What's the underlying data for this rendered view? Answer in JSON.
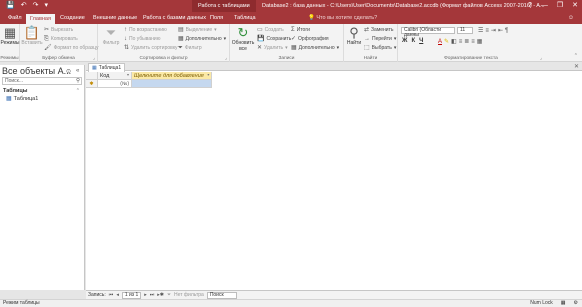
{
  "title_bar": {
    "context_tab": "Работа с таблицами",
    "title": "Database2 : база данных - C:\\Users\\User\\Documents\\Database2.accdb (Формат файлов Access 2007-2016) - A...",
    "qat": {
      "save": "💾",
      "undo": "↶",
      "redo": "↷",
      "more": "▾"
    },
    "controls": {
      "minimize": "—",
      "restore": "❐",
      "close": "✕",
      "help": "?"
    }
  },
  "tabs": {
    "file": "Файл",
    "home": "Главная",
    "create": "Создание",
    "external": "Внешние данные",
    "dbtools": "Работа с базами данных",
    "fields": "Поля",
    "table": "Таблица",
    "tellme": "Что вы хотите сделать?",
    "signin": "☺"
  },
  "ribbon": {
    "views": {
      "view_label": "Режимы",
      "group_label": "Режимы",
      "glyph": "▦"
    },
    "clipboard": {
      "paste": "Вставить",
      "cut": "Вырезать",
      "copy": "Копировать",
      "format_painter": "Формат по образцу",
      "group_label": "Буфер обмена"
    },
    "sort_filter": {
      "filter": "Фильтр",
      "ascending": "По возрастанию",
      "descending": "По убыванию",
      "remove_sort": "Удалить сортировку",
      "selection": "Выделение",
      "advanced": "Дополнительно",
      "toggle": "Фильтр",
      "group_label": "Сортировка и фильтр"
    },
    "records": {
      "refresh": "Обновить все",
      "new": "Создать",
      "save": "Сохранить",
      "delete": "Удалить",
      "totals": "Итоги",
      "spelling": "Орфография",
      "more": "Дополнительно",
      "group_label": "Записи"
    },
    "find": {
      "find": "Найти",
      "replace": "Заменить",
      "goto": "Перейти",
      "select": "Выбрать",
      "group_label": "Найти"
    },
    "text_format": {
      "font": "Calibri (Области данны",
      "size": "11",
      "bold": "Ж",
      "italic": "К",
      "underline": "Ч",
      "group_label": "Форматирование текста"
    }
  },
  "nav_pane": {
    "title": "Все объекты A...",
    "search_placeholder": "Поиск...",
    "category": "Таблицы",
    "items": [
      {
        "label": "Таблица1"
      }
    ]
  },
  "document": {
    "tab_label": "Таблица1",
    "columns": {
      "id": "Код",
      "add": "Щелкните для добавления"
    },
    "rows": [
      {
        "id": "(№)",
        "add": ""
      }
    ],
    "close": "✕"
  },
  "record_nav": {
    "label": "Запись:",
    "position": "1 из 1",
    "no_filter": "Нет фильтра",
    "search": "Поиск"
  },
  "status": {
    "left": "Режим таблицы",
    "num_lock": "Num Lock"
  },
  "colors": {
    "accent": "#a4373a",
    "ribbon_bg": "#f3f3f3",
    "header_add": "#fbe9a6",
    "selected_cell": "#c5d8ef"
  }
}
